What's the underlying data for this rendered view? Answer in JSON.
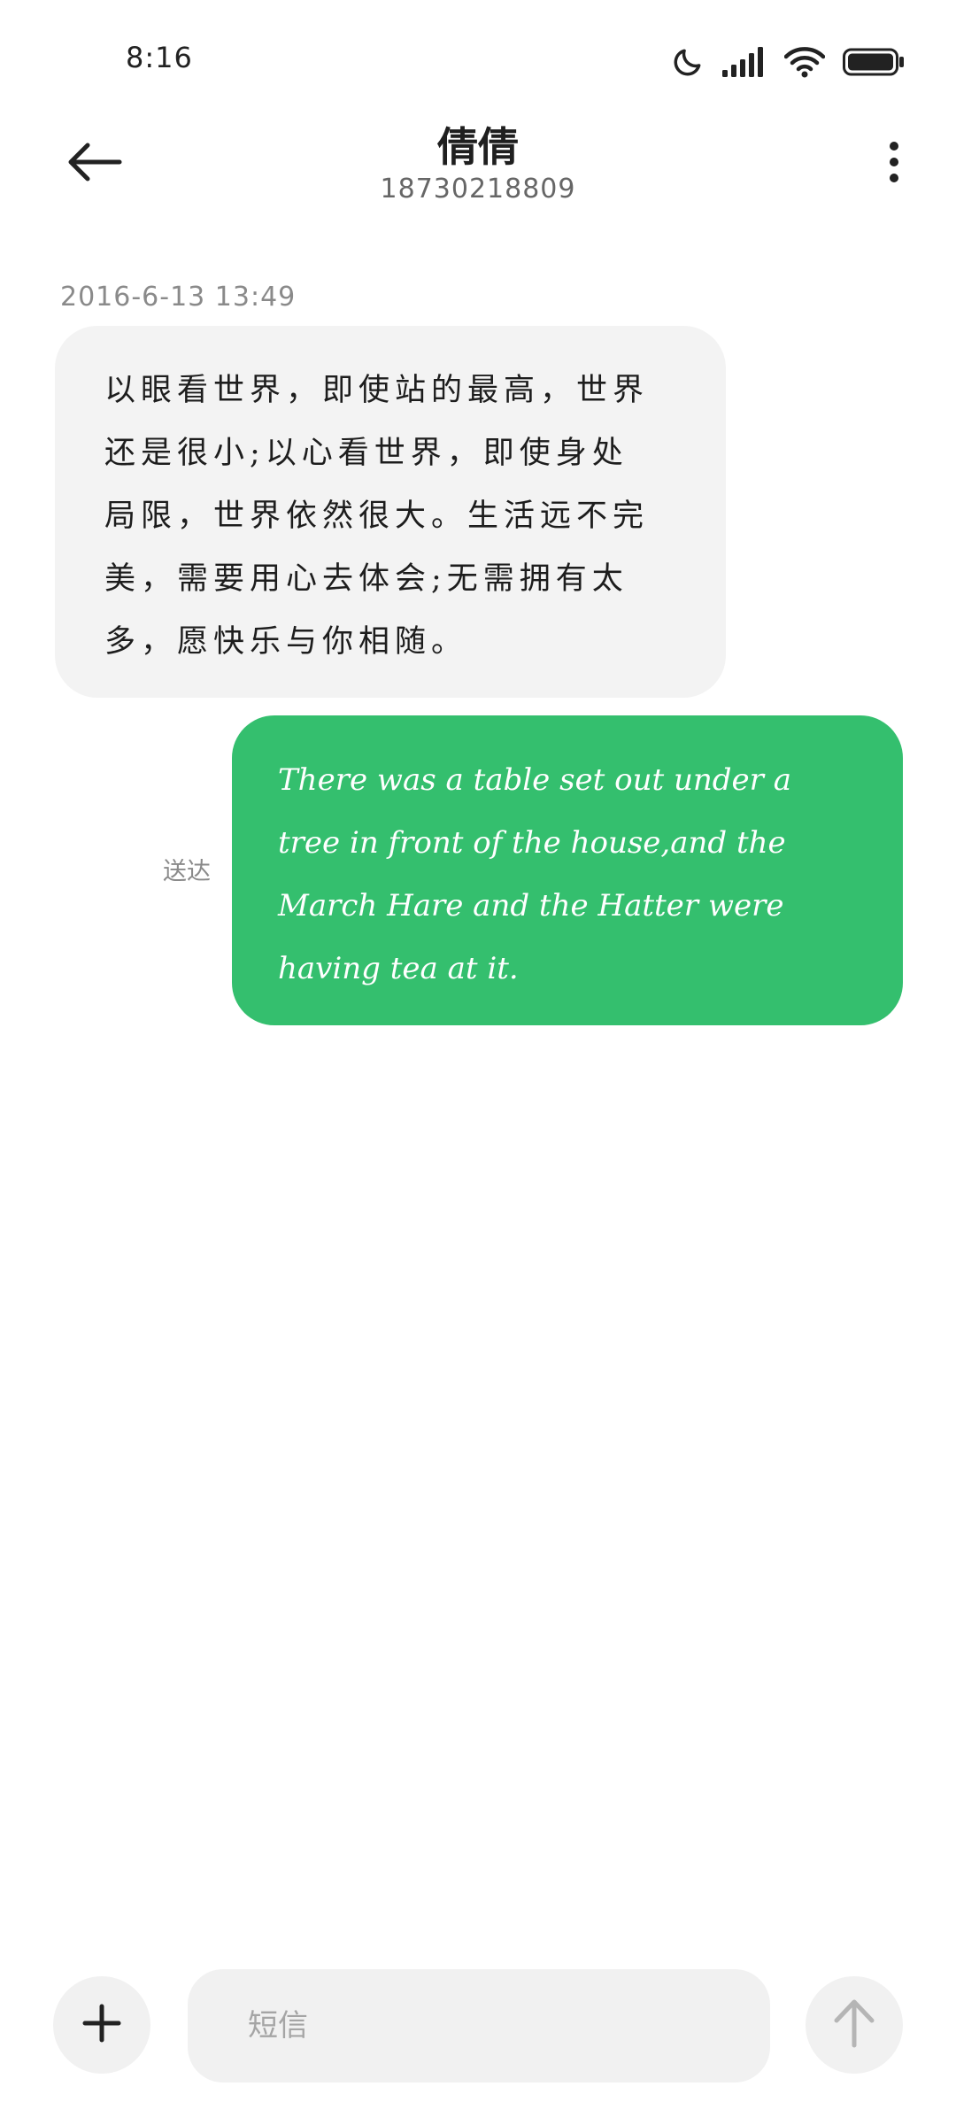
{
  "status_bar": {
    "time": "8:16",
    "icons": [
      "moon-icon",
      "signal-icon",
      "wifi-icon",
      "battery-icon"
    ]
  },
  "header": {
    "contact_name": "倩倩",
    "contact_number": "18730218809",
    "back_icon": "arrow-left-icon",
    "more_icon": "more-vertical-icon"
  },
  "conversation": {
    "timestamp": "2016-6-13 13:49",
    "incoming": {
      "lines": [
        "以眼看世界，即使站的最高，世界",
        "还是很小;以心看世界，即使身处",
        "局限，世界依然很大。生活远不完",
        "美，需要用心去体会;无需拥有太",
        "多，愿快乐与你相随。"
      ]
    },
    "outgoing": {
      "status": "送达",
      "lines": [
        "There was a table set out under a",
        "tree in front of the house,and the",
        "March Hare and the Hatter were",
        "having tea at it."
      ]
    }
  },
  "compose": {
    "placeholder": "短信",
    "add_icon": "plus-icon",
    "send_icon": "arrow-up-icon"
  },
  "colors": {
    "outgoing_bubble": "#34bf6e",
    "incoming_bubble": "#f3f3f3",
    "background": "#ffffff"
  }
}
